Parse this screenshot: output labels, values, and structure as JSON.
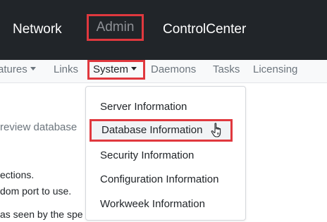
{
  "topnav": {
    "items": [
      "Network",
      "Admin",
      "ControlCenter"
    ]
  },
  "subnav": {
    "features_label": "atures",
    "links_label": "Links",
    "system_label": "System",
    "daemons_label": "Daemons",
    "tasks_label": "Tasks",
    "licensing_label": "Licensing"
  },
  "background_text": {
    "line1": "review database",
    "line2": "ections.",
    "line3": "dom port to use.",
    "line4": "as seen by the spe"
  },
  "system_menu": {
    "items": [
      "Server Information",
      "Database Information",
      "Security Information",
      "Configuration Information",
      "Workweek Information"
    ],
    "highlighted_index": 1
  },
  "colors": {
    "highlight_border": "#e0383e",
    "topbar_bg": "#212529"
  },
  "icons": {
    "pointer": "hand-pointer-icon"
  }
}
